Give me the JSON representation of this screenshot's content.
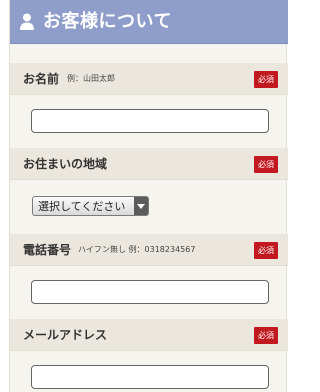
{
  "header": {
    "title": "お客様について",
    "icon": "user-icon"
  },
  "fields": [
    {
      "label": "お名前",
      "example": "例：山田太郎",
      "required": "必須",
      "value": ""
    },
    {
      "label": "お住まいの地域",
      "required": "必須",
      "select_value": "選択してください"
    },
    {
      "label": "電話番号",
      "example": "ハイフン無し 例：0318234567",
      "required": "必須",
      "value": ""
    },
    {
      "label": "メールアドレス",
      "required": "必須",
      "value": ""
    }
  ],
  "colors": {
    "header_bg": "#8e9dc9",
    "required_badge": "#c1191f",
    "label_bg": "#ebe7de",
    "form_bg": "#f6f4ef"
  }
}
